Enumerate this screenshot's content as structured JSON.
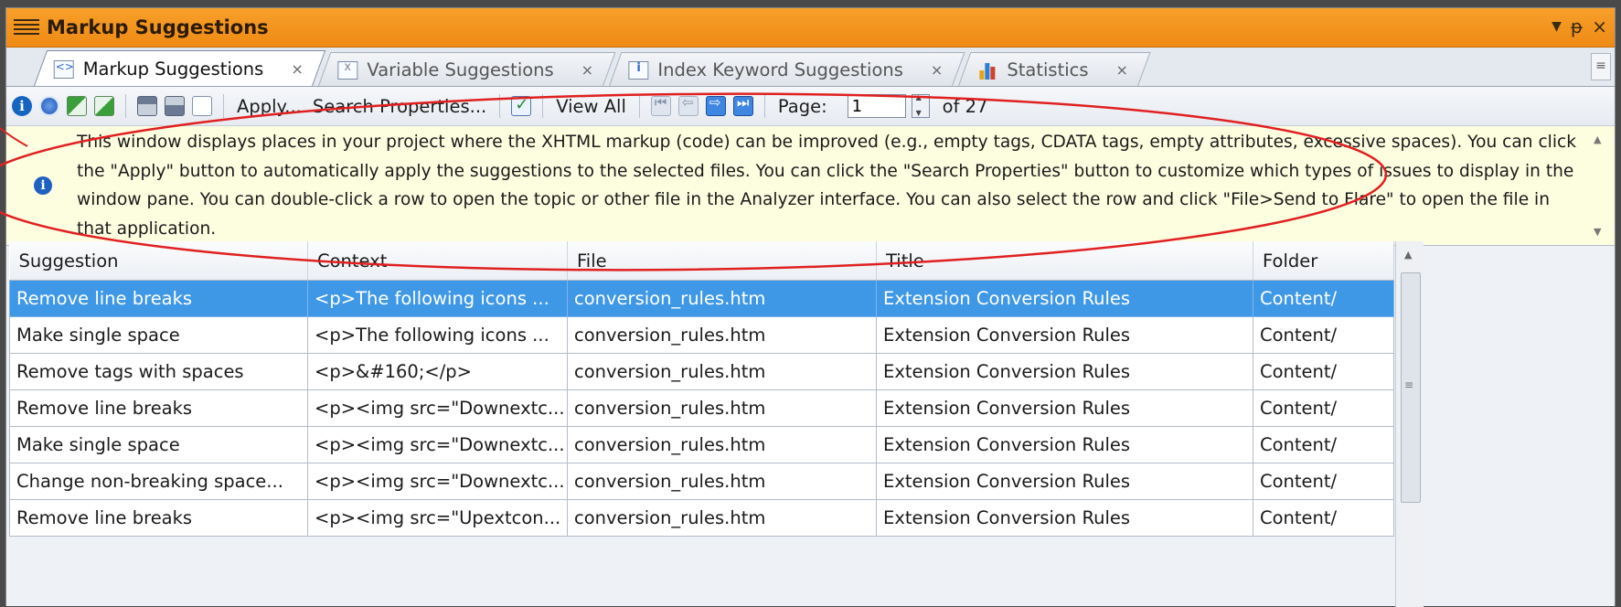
{
  "window": {
    "title": "Markup Suggestions",
    "controls": {
      "dropdown": "▼",
      "pin": "ᵽ",
      "close": "×"
    }
  },
  "tabs": [
    {
      "label": "Markup Suggestions",
      "icon": "code-icon",
      "active": true
    },
    {
      "label": "Variable Suggestions",
      "icon": "variable-icon",
      "active": false
    },
    {
      "label": "Index Keyword Suggestions",
      "icon": "index-icon",
      "active": false
    },
    {
      "label": "Statistics",
      "icon": "bar-chart-icon",
      "active": false
    }
  ],
  "toolbar": {
    "apply_label": "Apply...",
    "search_properties_label": "Search Properties...",
    "view_all_label": "View All",
    "page_label": "Page:",
    "page_value": "1",
    "page_of": "of 27"
  },
  "info": {
    "text": "This window displays places in your project where the XHTML markup (code) can be improved (e.g., empty tags, CDATA tags, empty attributes, excessive spaces). You can click the \"Apply\" button to automatically apply the suggestions to the selected files. You can click the \"Search Properties\" button to customize which types of issues to display in the window pane. You can double-click a row to open the topic or other file in the Analyzer interface. You can also select the row and click \"File>Send to Flare\" to open the file in that application."
  },
  "grid": {
    "columns": [
      "Suggestion",
      "Context",
      "File",
      "Title",
      "Folder"
    ],
    "rows": [
      [
        "Remove line breaks",
        "<p>The following icons ...",
        "conversion_rules.htm",
        "Extension Conversion Rules",
        "Content/"
      ],
      [
        "Make single space",
        "<p>The following icons ...",
        "conversion_rules.htm",
        "Extension Conversion Rules",
        "Content/"
      ],
      [
        "Remove tags with spaces",
        "<p>&#160;</p>",
        "conversion_rules.htm",
        "Extension Conversion Rules",
        "Content/"
      ],
      [
        "Remove line breaks",
        "<p><img src=\"Downextc...",
        "conversion_rules.htm",
        "Extension Conversion Rules",
        "Content/"
      ],
      [
        "Make single space",
        "<p><img src=\"Downextc...",
        "conversion_rules.htm",
        "Extension Conversion Rules",
        "Content/"
      ],
      [
        "Change non-breaking space...",
        "<p><img src=\"Downextc...",
        "conversion_rules.htm",
        "Extension Conversion Rules",
        "Content/"
      ],
      [
        "Remove line breaks",
        "<p><img src=\"Upextcon...",
        "conversion_rules.htm",
        "Extension Conversion Rules",
        "Content/"
      ]
    ],
    "selected_row": 0
  },
  "colors": {
    "title_bar": "#ee8a14",
    "selection": "#3f98e6",
    "info_background": "#fdfde0",
    "annotation": "#e02020"
  }
}
